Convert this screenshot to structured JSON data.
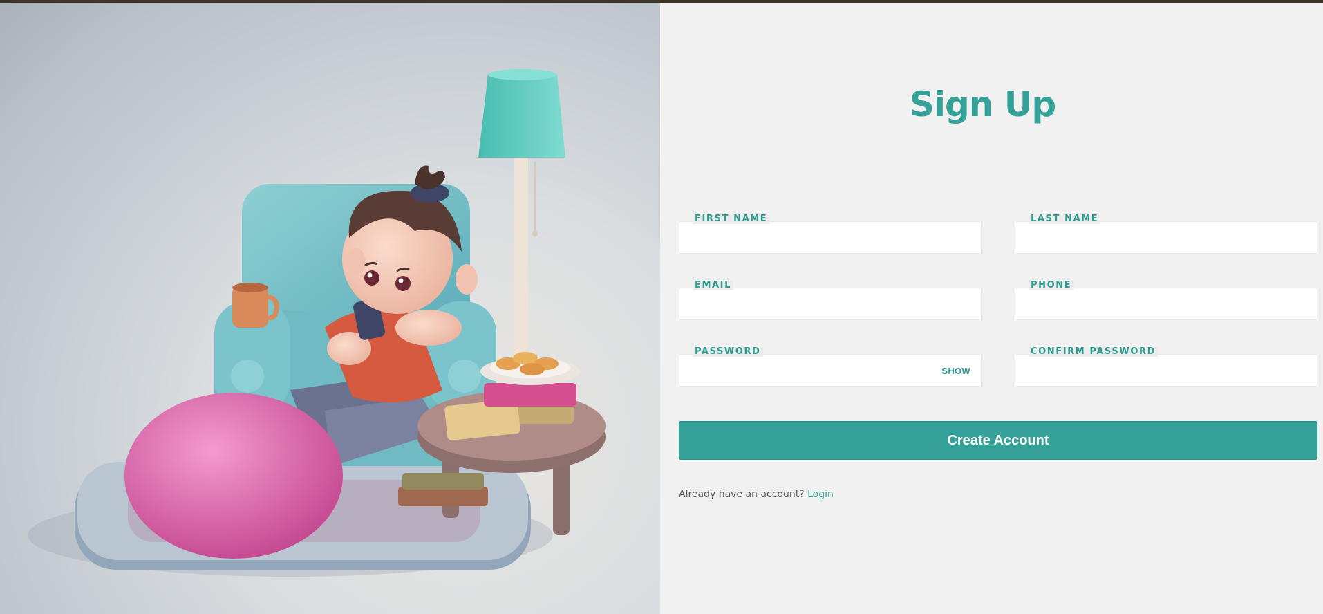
{
  "colors": {
    "accent": "#35a198",
    "panel_bg": "#f1f1f1",
    "topbar": "#3d3426"
  },
  "illustration": {
    "icon": "person-on-armchair-illustration"
  },
  "form": {
    "title": "Sign Up",
    "fields": {
      "first_name": {
        "label": "FIRST NAME",
        "value": ""
      },
      "last_name": {
        "label": "LAST NAME",
        "value": ""
      },
      "email": {
        "label": "EMAIL",
        "value": ""
      },
      "phone": {
        "label": "PHONE",
        "value": ""
      },
      "password": {
        "label": "PASSWORD",
        "value": "",
        "toggle_label": "SHOW"
      },
      "confirm_password": {
        "label": "CONFIRM PASSWORD",
        "value": ""
      }
    },
    "submit_label": "Create Account",
    "login_prompt": "Already have an account?",
    "login_link": "Login"
  }
}
